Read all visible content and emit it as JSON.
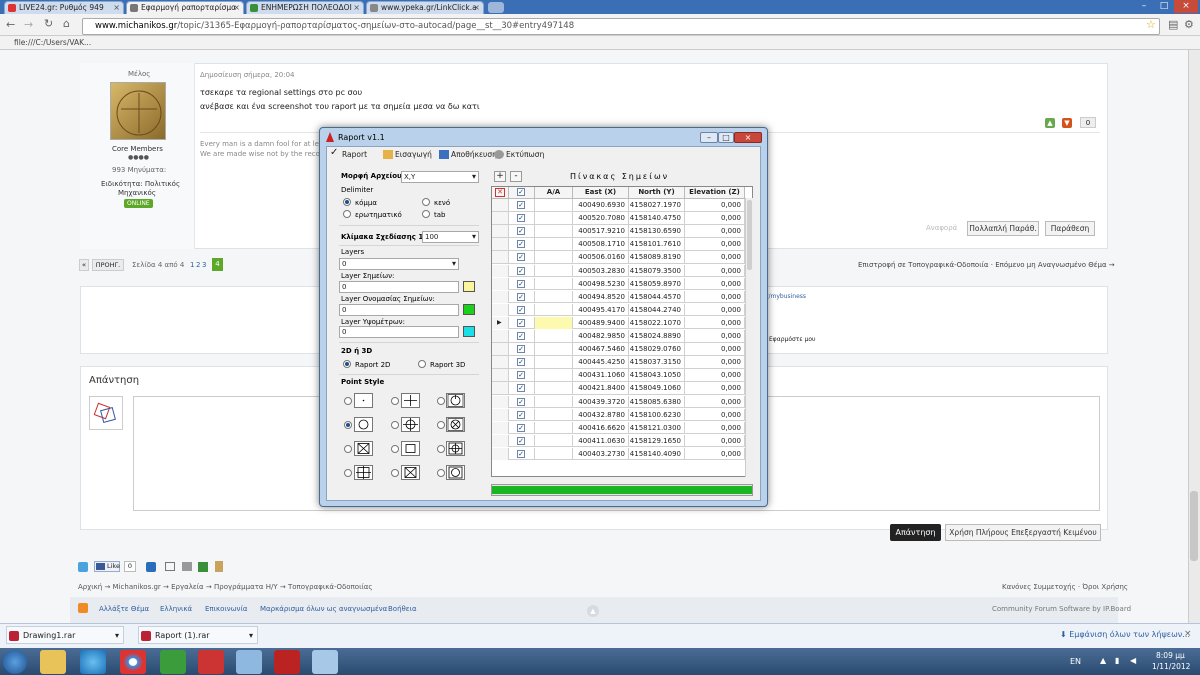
{
  "browser": {
    "tabs": [
      {
        "label": "LIVE24.gr: Ρυθμός 949",
        "color": "#d33"
      },
      {
        "label": "Εφαρμογή ραπορταρίσμα",
        "color": "#777"
      },
      {
        "label": "ΕΝΗΜΕΡΩΣΗ ΠΟΛΕΟΔΟΙ",
        "color": "#3a8f3a"
      },
      {
        "label": "www.ypeka.gr/LinkClick.a",
        "color": "#888"
      }
    ],
    "address": {
      "host": "www.michanikos.gr",
      "path": "/topic/31365-Εφαρμογή-ραπορταρίσματος-σημείων-στο-autocad/page__st__30#entry497148"
    },
    "bookmark": "file:///C:/Users/VAK..."
  },
  "post": {
    "role": "Μέλος",
    "date": "Δημοσίευση σήμερα, 20:04",
    "line1": "τσεκαρε τα regional settings στο pc σου",
    "line2": "ανέβασε και ένα screenshot του raport με τα σημεία μεσα να δω κατι",
    "sig1": "Every man is a damn fool for at lea",
    "sig2": "We are made wise not by the recoll",
    "group": "Core Members",
    "messages": "993 Μηνύματα:",
    "specialty_label": "Ειδικότητα: Πολιτικός",
    "specialty_value": "Μηχανικός",
    "online": "ONLINE",
    "votes": "0",
    "report": "Αναφορά",
    "multiquote": "Πολλαπλή Παράθ.",
    "quote": "Παράθεση"
  },
  "pagination": {
    "prev": "«",
    "prev_label": "ΠΡΟΗΓ.",
    "info": "Σελίδα 4 από 4",
    "pages": [
      "1",
      "2",
      "3",
      "4"
    ],
    "back": "Επιστροφή σε Τοπογραφικά-Οδοποιία · Επόμενο μη Αναγνωσμένο Θέμα →"
  },
  "share_fragment": "r/mybusiness",
  "share_fragment2": "Εφαρμόστε μου",
  "reply": {
    "title": "Απάντηση",
    "submit": "Απάντηση",
    "full_editor": "Χρήση Πλήρους Επεξεργαστή Κειμένου"
  },
  "footer": {
    "like": "Like",
    "like_count": "0",
    "breadcrumb": [
      "Αρχική",
      "Michanikos.gr",
      "Εργαλεία",
      "Προγράμματα Η/Υ",
      "Τοπογραφικά-Οδοποιίας"
    ],
    "terms": "Κανόνες Συμμετοχής · Όροι Χρήσης",
    "links": [
      "Αλλάξτε Θέμα",
      "Ελληνικά",
      "Επικοινωνία",
      "Μαρκάρισμα όλων ως αναγνωσμένα",
      "Βοήθεια"
    ],
    "credit": "Community Forum Software by IP.Board"
  },
  "downloads": {
    "items": [
      "Drawing1.rar",
      "Raport (1).rar"
    ],
    "show_all": "Εμφάνιση όλων των λήψεων..."
  },
  "taskbar": {
    "lang": "EN",
    "time": "8:09 μμ",
    "date": "1/11/2012"
  },
  "dialog": {
    "title": "Raport v1.1",
    "menu": [
      "Raport",
      "Εισαγωγή",
      "Αποθήκευση",
      "Εκτύπωση"
    ],
    "format_label": "Μορφή Αρχείου:",
    "format_value": "X,Y",
    "delimiter_label": "Delimiter",
    "delimiters": [
      "κόμμα",
      "κενό",
      "ερωτηματικό",
      "tab"
    ],
    "scale_label": "Κλίμακα Σχεδίασης 1/:",
    "scale_value": "100",
    "layers_label": "Layers",
    "layers_value": "0",
    "layer_points_label": "Layer Σημείων:",
    "layer_points_value": "0",
    "layer_names_label": "Layer Ονομασίας Σημείων:",
    "layer_names_value": "0",
    "layer_heights_label": "Layer Υψομέτρων:",
    "layer_heights_value": "0",
    "dim_label": "2D ή 3D",
    "dim_2d": "Raport 2D",
    "dim_3d": "Raport 3D",
    "point_style_label": "Point Style",
    "table_title": "Πίνακας Σημείων",
    "add": "+",
    "remove": "-",
    "clear": "✕",
    "columns": [
      "A/A",
      "East (X)",
      "North (Y)",
      "Elevation (Z)"
    ],
    "rows": [
      [
        "400490.6930",
        "4158027.1970",
        "0,000"
      ],
      [
        "400520.7080",
        "4158140.4750",
        "0,000"
      ],
      [
        "400517.9210",
        "4158130.6590",
        "0,000"
      ],
      [
        "400508.1710",
        "4158101.7610",
        "0,000"
      ],
      [
        "400506.0160",
        "4158089.8190",
        "0,000"
      ],
      [
        "400503.2830",
        "4158079.3500",
        "0,000"
      ],
      [
        "400498.5230",
        "4158059.8970",
        "0,000"
      ],
      [
        "400494.8520",
        "4158044.4570",
        "0,000"
      ],
      [
        "400495.4170",
        "4158044.2740",
        "0,000"
      ],
      [
        "400489.9400",
        "4158022.1070",
        "0,000"
      ],
      [
        "400482.9850",
        "4158024.8890",
        "0,000"
      ],
      [
        "400467.5460",
        "4158029.0760",
        "0,000"
      ],
      [
        "400445.4250",
        "4158037.3150",
        "0,000"
      ],
      [
        "400431.1060",
        "4158043.1050",
        "0,000"
      ],
      [
        "400421.8400",
        "4158049.1060",
        "0,000"
      ],
      [
        "400439.3720",
        "4158085.6380",
        "0,000"
      ],
      [
        "400432.8780",
        "4158100.6230",
        "0,000"
      ],
      [
        "400416.6620",
        "4158121.0300",
        "0,000"
      ],
      [
        "400411.0630",
        "4158129.1650",
        "0,000"
      ],
      [
        "400403.2730",
        "4158140.4090",
        "0,000"
      ]
    ],
    "progress": 1.0
  }
}
